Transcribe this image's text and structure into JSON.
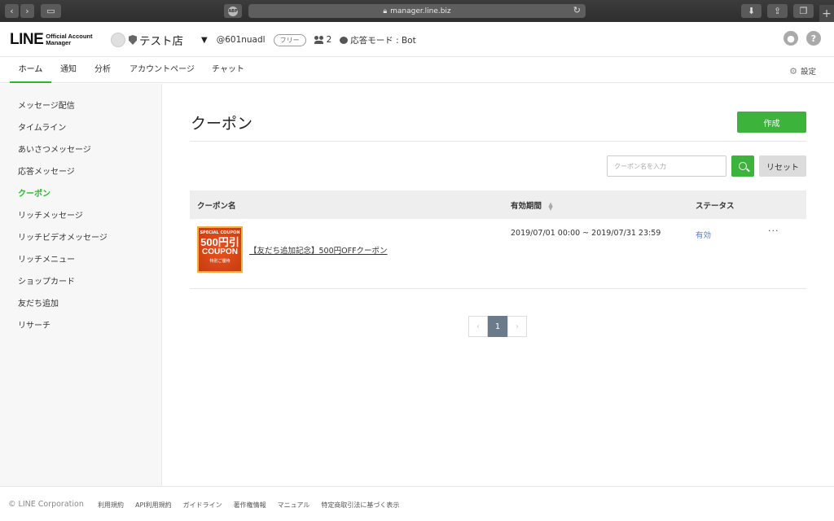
{
  "browser": {
    "url": "manager.line.biz",
    "abp_label": "ABP"
  },
  "header": {
    "logo_main": "LINE",
    "logo_sub_1": "Official Account",
    "logo_sub_2": "Manager",
    "account_name": "テスト店",
    "account_id": "@601nuadl",
    "plan_badge": "フリー",
    "friend_count": "2",
    "response_mode": "応答モード : Bot"
  },
  "tabs": [
    {
      "label": "ホーム"
    },
    {
      "label": "通知"
    },
    {
      "label": "分析"
    },
    {
      "label": "アカウントページ"
    },
    {
      "label": "チャット"
    }
  ],
  "settings_label": "設定",
  "sidebar": {
    "items": [
      {
        "label": "メッセージ配信"
      },
      {
        "label": "タイムライン"
      },
      {
        "label": "あいさつメッセージ"
      },
      {
        "label": "応答メッセージ"
      },
      {
        "label": "クーポン"
      },
      {
        "label": "リッチメッセージ"
      },
      {
        "label": "リッチビデオメッセージ"
      },
      {
        "label": "リッチメニュー"
      },
      {
        "label": "ショップカード"
      },
      {
        "label": "友だち追加"
      },
      {
        "label": "リサーチ"
      }
    ],
    "active_index": 4
  },
  "main": {
    "title": "クーポン",
    "create_label": "作成",
    "search_placeholder": "クーポン名を入力",
    "reset_label": "リセット",
    "columns": {
      "name": "クーポン名",
      "period": "有効期間",
      "status": "ステータス"
    },
    "rows": [
      {
        "thumb_line1": "SPECIAL COUPON",
        "thumb_line2": "500円引",
        "thumb_line3": "COUPON",
        "thumb_line4": "特別ご優待",
        "name": "【友だち追加記念】500円OFFクーポン",
        "period": "2019/07/01 00:00 ~ 2019/07/31 23:59",
        "status": "有効",
        "more": "···"
      }
    ],
    "pagination": {
      "prev": "‹",
      "current": "1",
      "next": "›"
    }
  },
  "footer": {
    "copyright": "© LINE Corporation",
    "links": [
      "利用規約",
      "API利用規約",
      "ガイドライン",
      "著作権情報",
      "マニュアル",
      "特定商取引法に基づく表示"
    ]
  },
  "colors": {
    "accent": "#2bb92b",
    "status_link": "#4f7bd1"
  }
}
